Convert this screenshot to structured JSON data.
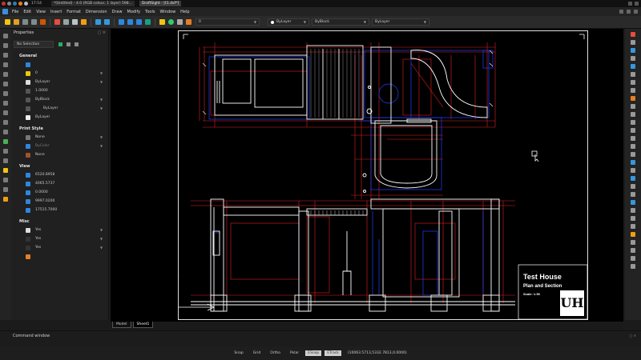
{
  "taskbar": {
    "clock": "17:54",
    "windows": [
      {
        "label": "*(Untitled) - 4.0 (RGB colour, 1 layer) 598..."
      },
      {
        "label": "DraftSight - [t1.dxf*]"
      }
    ]
  },
  "menubar": {
    "items": [
      "File",
      "Edit",
      "View",
      "Insert",
      "Format",
      "Dimension",
      "Draw",
      "Modify",
      "Tools",
      "Window",
      "Help"
    ]
  },
  "toolbar": {
    "layer_value": "0",
    "color_value": "ByLayer",
    "linestyle_value": "ByBlock",
    "lineweight_value": "ByLayer"
  },
  "properties": {
    "title": "Properties",
    "selection": "No Selection",
    "sections": {
      "general": {
        "label": "General",
        "rows": [
          {
            "icon": "color-icon",
            "value": ""
          },
          {
            "icon": "layer-icon",
            "value": "0"
          },
          {
            "icon": "pen-color-icon",
            "value": "ByLayer"
          },
          {
            "icon": "scale-icon",
            "value": "1.0000"
          },
          {
            "icon": "linestyle-icon",
            "value": "ByBlock"
          },
          {
            "icon": "lineweight-icon",
            "value": "ByLayer"
          },
          {
            "icon": "transparency-icon",
            "value": "ByLayer"
          }
        ]
      },
      "print_style": {
        "label": "Print Style",
        "rows": [
          {
            "icon": "print-style-icon",
            "value": "None"
          },
          {
            "icon": "print-color-icon",
            "value": "ByColor"
          },
          {
            "icon": "print-table-icon",
            "value": "None"
          }
        ]
      },
      "view": {
        "label": "View",
        "rows": [
          {
            "icon": "center-x-icon",
            "value": "6520.8958"
          },
          {
            "icon": "center-y-icon",
            "value": "4065.5737"
          },
          {
            "icon": "center-z-icon",
            "value": "0.0000"
          },
          {
            "icon": "height-icon",
            "value": "9997.0200"
          },
          {
            "icon": "width-icon",
            "value": "17515.7000"
          }
        ]
      },
      "misc": {
        "label": "Misc",
        "rows": [
          {
            "icon": "ucs-icon",
            "value": "Yes"
          },
          {
            "icon": "ucs-origin-icon",
            "value": "Yes"
          },
          {
            "icon": "ucs-per-viewport-icon",
            "value": "Yes"
          },
          {
            "icon": "ucs-name-icon",
            "value": ""
          }
        ]
      }
    }
  },
  "drawing": {
    "title_block": {
      "title": "Test House",
      "subtitle": "Plan and Section",
      "scale": "Scale: 1:50",
      "logo": "UH"
    }
  },
  "tabs": [
    "Model",
    "Sheet1"
  ],
  "active_tab": "Sheet1",
  "command_window": {
    "title": "Command window"
  },
  "status": {
    "toggles": [
      "Snap",
      "Grid",
      "Ortho",
      "Polar",
      "ESnap",
      "ETrack"
    ],
    "coords": "(10063.5713,5332.7813,0.0000)"
  },
  "colors": {
    "red": "#e02020",
    "blue": "#2040ff",
    "white": "#ffffff",
    "background": "#000000"
  }
}
